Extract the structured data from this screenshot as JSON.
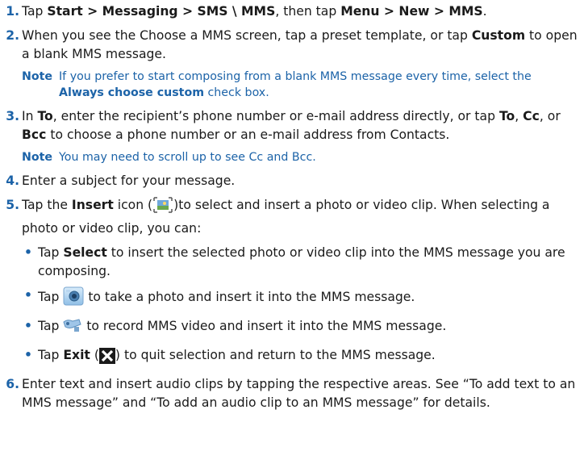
{
  "step1": {
    "num": "1.",
    "t1": "Tap ",
    "b1": "Start > Messaging > SMS \\ MMS",
    "t2": ", then tap ",
    "b2": "Menu > New > MMS",
    "t3": "."
  },
  "step2": {
    "num": "2.",
    "t1": "When you see the Choose a MMS screen, tap a preset template, or tap ",
    "b1": "Custom",
    "t2": " to open a blank MMS message."
  },
  "note1": {
    "label": "Note",
    "t1": "If you prefer to start composing from a blank MMS message every time, select the ",
    "b1": "Always choose custom",
    "t2": " check box."
  },
  "step3": {
    "num": "3.",
    "t1": "In ",
    "b1": "To",
    "t2": ", enter the recipient’s phone number or e-mail address directly, or tap ",
    "b2": "To",
    "t3": ", ",
    "b3": "Cc",
    "t4": ", or ",
    "b4": "Bcc",
    "t5": " to choose a phone number or an e-mail address from Contacts."
  },
  "note2": {
    "label": "Note",
    "t1": "You may need to scroll up to see Cc and Bcc."
  },
  "step4": {
    "num": "4.",
    "t1": "Enter a subject for your message."
  },
  "step5": {
    "num": "5.",
    "t1": "Tap the ",
    "b1": "Insert",
    "t2": " icon (",
    "t3": ")to select and insert a photo or video clip. When selecting a photo or video clip, you can:"
  },
  "bullets": {
    "b1": {
      "t1": "Tap ",
      "b1": "Select",
      "t2": " to insert the selected photo or video clip into the MMS message you are composing."
    },
    "b2": {
      "t1": "Tap ",
      "t2": " to take a photo and insert it into the MMS message."
    },
    "b3": {
      "t1": "Tap ",
      "t2": " to record MMS video and insert it into the MMS message."
    },
    "b4": {
      "t1": "Tap ",
      "b1": "Exit",
      "t2": " (",
      "t3": ") to quit selection and return to the MMS message."
    }
  },
  "step6": {
    "num": "6.",
    "t1": "Enter text and insert audio clips by tapping the respective areas. See “To add text to an MMS message” and “To add an audio clip to an MMS message” for details."
  },
  "icons": {
    "insert": "insert-picture-icon",
    "camera": "camera-icon",
    "video": "video-camera-icon",
    "exit": "exit-x-icon"
  },
  "colors": {
    "accent": "#1c63a8",
    "text": "#1a1a1a"
  }
}
